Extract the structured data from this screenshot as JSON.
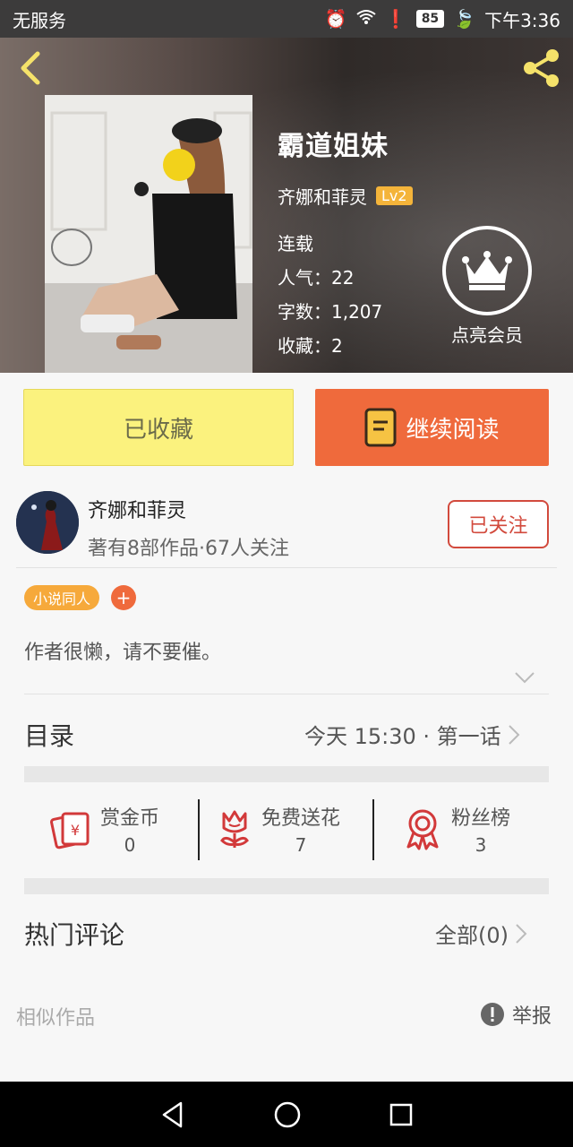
{
  "status": {
    "carrier": "无服务",
    "battery": "85",
    "time": "下午3:36"
  },
  "book": {
    "title": "霸道姐妹",
    "author": "齐娜和菲灵",
    "level": "Lv2",
    "state": "连载",
    "popularity": "人气：22",
    "words": "字数：1,207",
    "favorites": "收藏：2",
    "vip_label": "点亮会员"
  },
  "actions": {
    "favorited": "已收藏",
    "continue": "继续阅读"
  },
  "author": {
    "name": "齐娜和菲灵",
    "sub": "著有8部作品·67人关注",
    "follow": "已关注"
  },
  "tags": {
    "tag1": "小说同人",
    "add": "+"
  },
  "intro": "作者很懒，请不要催。",
  "catalog": {
    "label": "目录",
    "latest": "今天 15:30 · 第一话"
  },
  "stats": [
    {
      "label": "赏金币",
      "value": "0"
    },
    {
      "label": "免费送花",
      "value": "7"
    },
    {
      "label": "粉丝榜",
      "value": "3"
    }
  ],
  "comments": {
    "label": "热门评论",
    "all": "全部(0)"
  },
  "footer": {
    "similar": "相似作品",
    "report": "举报"
  },
  "colors": {
    "accent_orange": "#ef6a3c",
    "fav_yellow": "#fbf27e",
    "follow_red": "#d24a3d",
    "level_gold": "#f4b43a"
  }
}
